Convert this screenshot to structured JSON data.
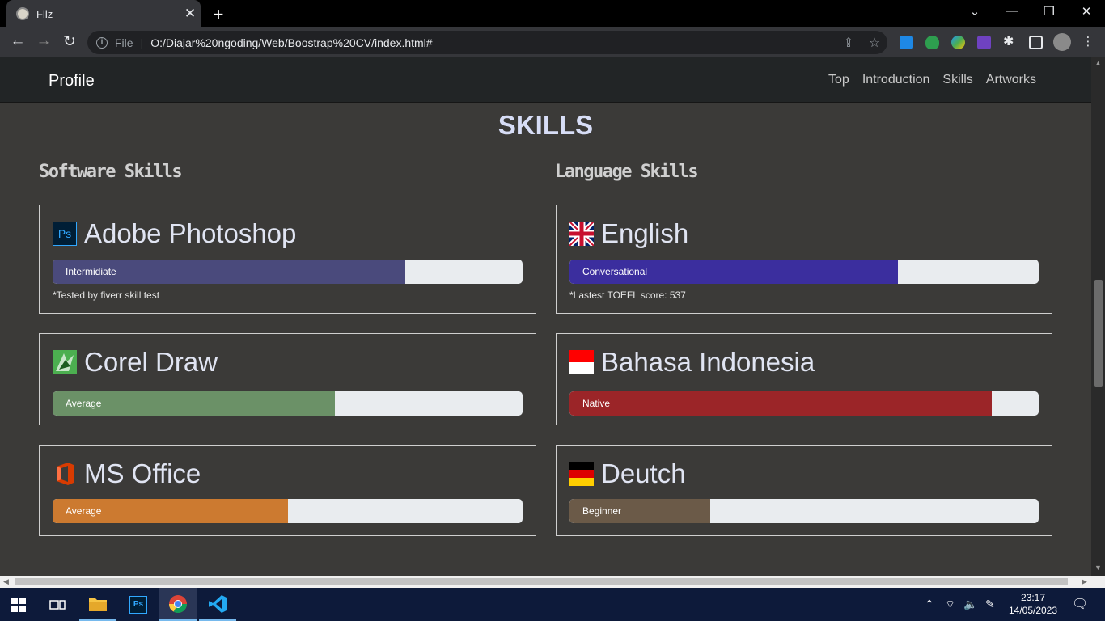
{
  "browser": {
    "tab_title": "Fllz",
    "new_tab": "+",
    "tab_close": "✕",
    "url_scheme_label": "File",
    "url_separator": "|",
    "url": "O:/Diajar%20ngoding/Web/Boostrap%20CV/index.html#",
    "icons": [
      "back-icon",
      "forward-icon",
      "reload-icon",
      "info-icon",
      "share-icon",
      "star-icon",
      "extensions-icon",
      "side-panel-icon",
      "profile-icon"
    ]
  },
  "navbar": {
    "brand": "Profile",
    "links": [
      "Top",
      "Introduction",
      "Skills",
      "Artworks"
    ]
  },
  "skills": {
    "heading": "SKILLS",
    "software_title": "Software Skills",
    "language_title": "Language Skills",
    "software": [
      {
        "name": "Adobe Photoshop",
        "icon": "photoshop-icon",
        "icon_text": "Ps",
        "level": "Intermidiate",
        "percent": 75,
        "color": "#4a4a7c",
        "note": "*Tested by fiverr skill test"
      },
      {
        "name": "Corel Draw",
        "icon": "coreldraw-icon",
        "level": "Average",
        "percent": 60,
        "color": "#6b9167",
        "note": ""
      },
      {
        "name": "MS Office",
        "icon": "msoffice-icon",
        "level": "Average",
        "percent": 50,
        "color": "#cc7a30",
        "note": ""
      }
    ],
    "language": [
      {
        "name": "English",
        "icon": "uk-flag-icon",
        "level": "Conversational",
        "percent": 70,
        "color": "#3b2e9e",
        "note": "*Lastest TOEFL score: 537"
      },
      {
        "name": "Bahasa Indonesia",
        "icon": "indonesia-flag-icon",
        "level": "Native",
        "percent": 90,
        "color": "#9b2528",
        "note": ""
      },
      {
        "name": "Deutch",
        "icon": "germany-flag-icon",
        "level": "Beginner",
        "percent": 30,
        "color": "#6b5a48",
        "note": ""
      }
    ]
  },
  "taskbar": {
    "time": "23:17",
    "date": "14/05/2023",
    "apps": [
      "windows-start-icon",
      "task-view-icon",
      "file-explorer-icon",
      "photoshop-app-icon",
      "chrome-app-icon",
      "vscode-app-icon"
    ]
  }
}
